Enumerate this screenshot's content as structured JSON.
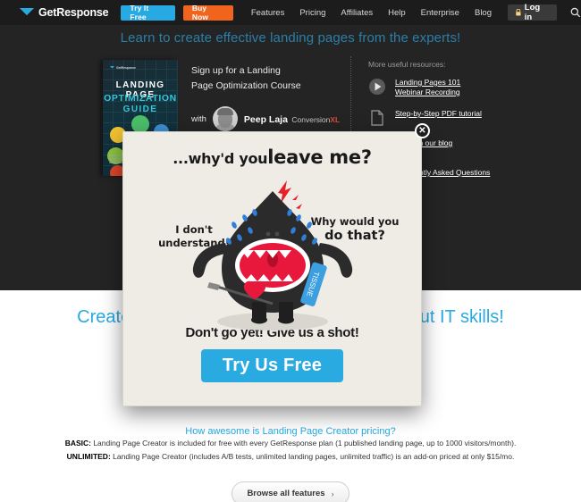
{
  "navbar": {
    "brand": "GetResponse",
    "brand_icon": "envelope-icon",
    "try_free_label": "Try It Free",
    "buy_now_label": "Buy Now",
    "links": [
      "Features",
      "Pricing",
      "Affiliates",
      "Help",
      "Enterprise",
      "Blog"
    ],
    "login_label": "Log in",
    "login_icon": "lock-icon",
    "search_icon": "search-icon",
    "colors": {
      "try_free": "#27a9e3",
      "buy_now": "#f0641e",
      "bar": "#1c1c1c"
    }
  },
  "hero": {
    "title": "Learn to create effective landing pages from the experts!",
    "book": {
      "logo": "GetResponse",
      "line1": "LANDING PAGE",
      "line2": "OPTIMIZATION",
      "line3": "GUIDE"
    },
    "signup": {
      "line1": "Sign up for a Landing",
      "line2": "Page Optimization Course",
      "with_label": "with",
      "speaker_name": "Peep Laja",
      "speaker_title": "Conversion",
      "speaker_title_accent": "XL"
    },
    "resources": {
      "heading": "More useful resources:",
      "items": [
        {
          "icon": "play-circle-icon",
          "lines": [
            "Landing Pages 101",
            "Webinar Recording"
          ]
        },
        {
          "icon": "document-icon",
          "lines": [
            "Step-by-Step PDF tutorial"
          ]
        },
        {
          "icon": "blog-icon",
          "lines": [
            "More on our blog"
          ]
        },
        {
          "icon": "faq-icon",
          "lines": [
            "Frequently Asked Questions"
          ]
        }
      ]
    }
  },
  "white_section": {
    "title": "Create high converting landing pages without IT skills!",
    "pricing_heading": "How awesome is Landing Page Creator pricing?",
    "pricing_rows": [
      {
        "label": "BASIC:",
        "text": " Landing Page Creator is included for free with every GetResponse plan (1 published landing page, up to 1000 visitors/month)."
      },
      {
        "label": "UNLIMITED:",
        "text": " Landing Page Creator (includes A/B tests, unlimited landing pages, unlimited traffic) is an add-on priced at only $15/mo."
      }
    ],
    "browse_label": "Browse all features",
    "browse_chevron": "›"
  },
  "modal": {
    "close_icon": "close-icon",
    "headline_small": "...why'd you",
    "headline_big": "leave me?",
    "bubble_left": "I don't understand!",
    "bubble_right_line1": "Why would you",
    "bubble_right_line2": "do that?",
    "cta_text": "Don't go yet! Give us a shot!",
    "button_label": "Try Us Free",
    "button_color": "#29aae1",
    "background": "#eeece5"
  }
}
